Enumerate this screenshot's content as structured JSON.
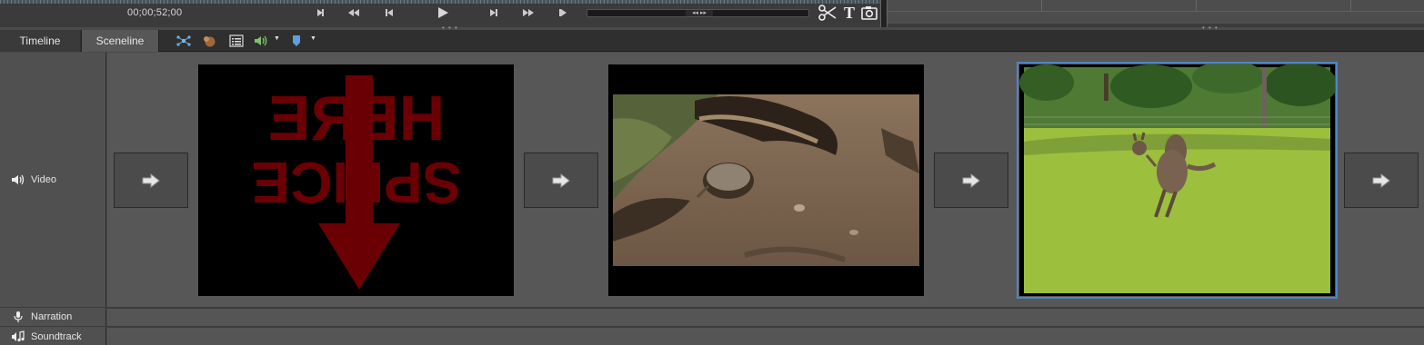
{
  "monitor": {
    "timecode": "00;00;52;00"
  },
  "tabs": {
    "timeline": "Timeline",
    "sceneline": "Sceneline",
    "active": "Sceneline"
  },
  "tracks": {
    "video": "Video",
    "narration": "Narration",
    "soundtrack": "Soundtrack"
  },
  "scenes": [
    {
      "name": "splice-here-title",
      "title_line_1": "HERE",
      "title_line_2": "SPLICE",
      "selected": false
    },
    {
      "name": "echidna-burrow",
      "selected": false
    },
    {
      "name": "kangaroo-field",
      "selected": true
    }
  ],
  "colors": {
    "selection": "#4d86c6",
    "title_red": "#6a0004"
  },
  "icons": [
    "go-to-in-icon",
    "previous-edit-icon",
    "step-back-icon",
    "play-icon",
    "step-forward-icon",
    "next-edit-icon",
    "go-to-out-icon",
    "scissors-icon",
    "title-text-icon",
    "snapshot-icon",
    "effects-icon",
    "smart-fix-icon",
    "properties-list-icon",
    "volume-icon",
    "marker-icon",
    "transition-arrow-icon",
    "speaker-icon",
    "microphone-icon",
    "music-speaker-icon"
  ]
}
